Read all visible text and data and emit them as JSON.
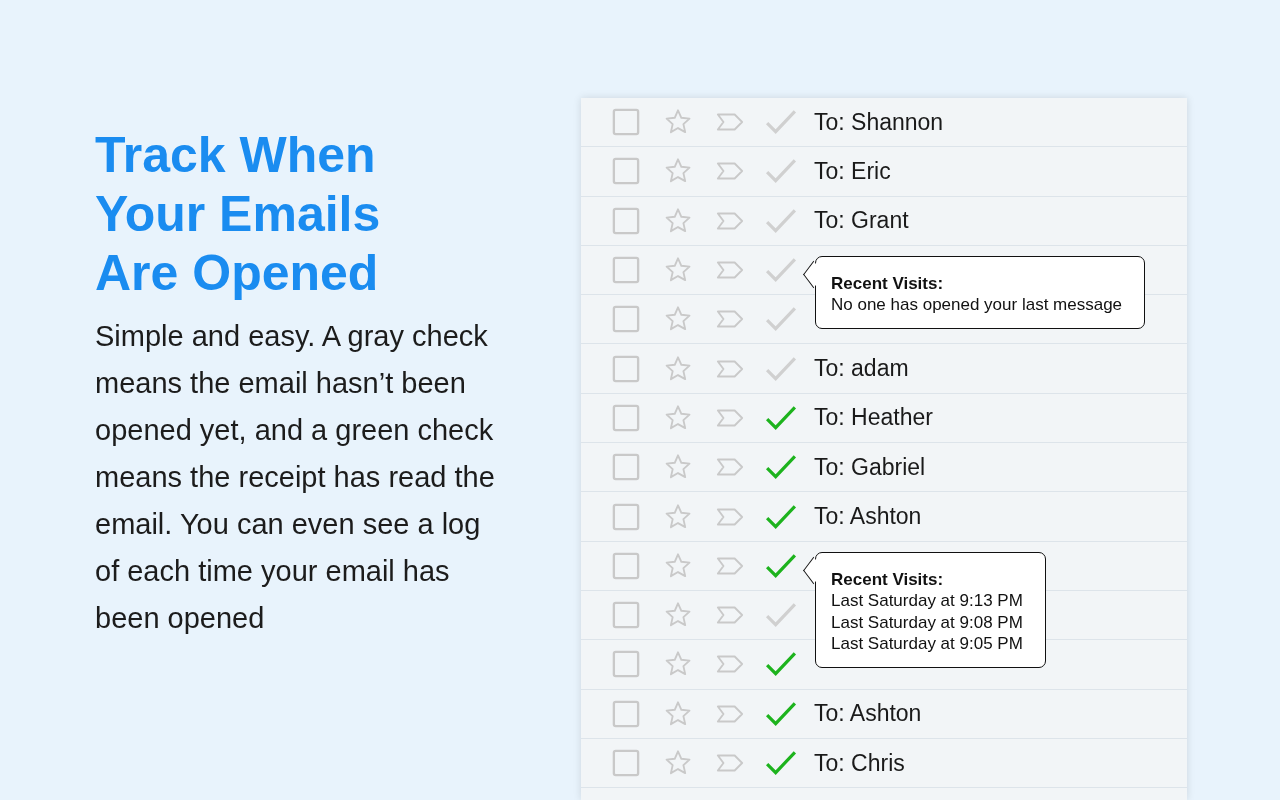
{
  "intro": {
    "heading": "Track When Your Emails Are Opened",
    "body": "Simple and easy. A gray check means the email hasn’t been opened yet, and a green check means the receipt has read the email. You can even see a log of each time your email has been opened"
  },
  "rows": [
    {
      "checked": false,
      "starred": false,
      "recipient": "To: Shannon",
      "opened": false
    },
    {
      "checked": false,
      "starred": false,
      "recipient": "To: Eric",
      "opened": false
    },
    {
      "checked": false,
      "starred": false,
      "recipient": "To: Grant",
      "opened": false
    },
    {
      "checked": false,
      "starred": false,
      "opened": false,
      "popup": {
        "title": "Recent Visits:",
        "lines": [
          "No one has opened your last message"
        ]
      }
    },
    {
      "checked": false,
      "starred": false,
      "opened": false
    },
    {
      "checked": false,
      "starred": false,
      "recipient": "To: adam",
      "opened": false
    },
    {
      "checked": false,
      "starred": false,
      "recipient": "To: Heather",
      "opened": true
    },
    {
      "checked": false,
      "starred": false,
      "recipient": "To: Gabriel",
      "opened": true
    },
    {
      "checked": false,
      "starred": false,
      "recipient": "To: Ashton",
      "opened": true
    },
    {
      "checked": false,
      "starred": false,
      "opened": true,
      "popup": {
        "title": "Recent Visits:",
        "lines": [
          "Last Saturday at 9:13 PM",
          "Last Saturday at 9:08 PM",
          "Last Saturday at 9:05 PM"
        ]
      }
    },
    {
      "checked": false,
      "starred": false,
      "opened": false
    },
    {
      "checked": false,
      "starred": false,
      "opened": true
    },
    {
      "checked": false,
      "starred": false,
      "recipient": "To: Ashton",
      "opened": true
    },
    {
      "checked": false,
      "starred": false,
      "recipient": "To: Chris",
      "opened": true
    }
  ]
}
